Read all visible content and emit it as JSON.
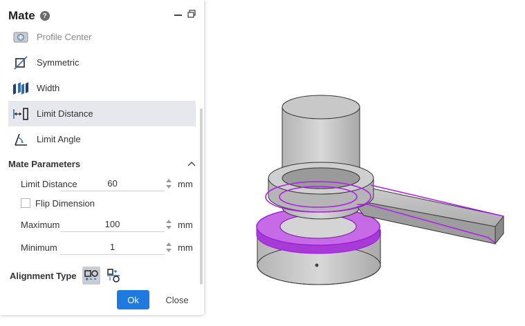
{
  "panel": {
    "title": "Mate",
    "help_glyph": "?"
  },
  "mate_types": [
    {
      "label": "Profile Center",
      "icon": "profile-center-icon"
    },
    {
      "label": "Symmetric",
      "icon": "symmetric-icon"
    },
    {
      "label": "Width",
      "icon": "width-icon"
    },
    {
      "label": "Limit Distance",
      "icon": "limit-distance-icon"
    },
    {
      "label": "Limit Angle",
      "icon": "limit-angle-icon"
    }
  ],
  "parameters": {
    "section_title": "Mate Parameters",
    "limit_distance": {
      "label": "Limit Distance",
      "value": "60",
      "unit": "mm"
    },
    "flip_dimension": {
      "label": "Flip Dimension",
      "checked": false
    },
    "maximum": {
      "label": "Maximum",
      "value": "100",
      "unit": "mm"
    },
    "minimum": {
      "label": "Minimum",
      "value": "1",
      "unit": "mm"
    }
  },
  "alignment": {
    "label": "Alignment Type"
  },
  "actions": {
    "ok_label": "Ok",
    "close_label": "Close"
  },
  "colors": {
    "accent": "#1f7ae0",
    "selection": "#c020ff",
    "icon_blue": "#2a6fb5"
  }
}
